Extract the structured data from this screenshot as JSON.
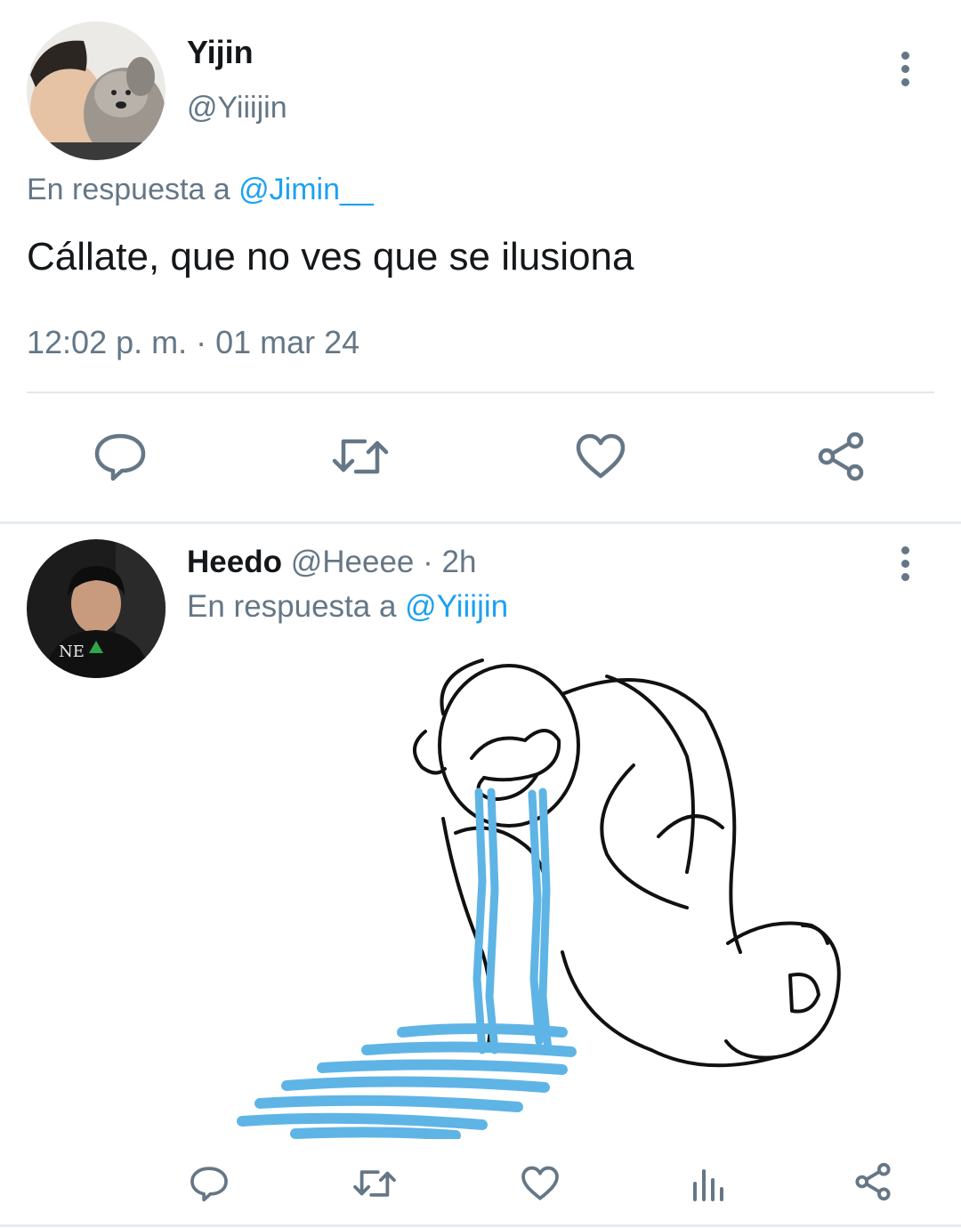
{
  "tweet": {
    "author": {
      "name": "Yijin",
      "handle": "@Yiiijin"
    },
    "reply_prefix": "En respuesta a",
    "reply_to": "@Jimin__",
    "text": "Cállate, que no ves que se ilusiona",
    "timestamp": "12:02 p. m. · 01 mar 24",
    "actions": [
      "reply-icon",
      "retweet-icon",
      "like-icon",
      "share-icon"
    ]
  },
  "reply": {
    "author": {
      "name": "Heedo",
      "handle": "@Heeee",
      "time": "· 2h"
    },
    "reply_prefix": "En respuesta a",
    "reply_to": "@Yiiijin",
    "media": "crying-cartoon-image",
    "actions": [
      "reply-icon",
      "retweet-icon",
      "like-icon",
      "analytics-icon",
      "share-icon"
    ]
  },
  "colors": {
    "accent": "#1da1f2",
    "muted": "#657786",
    "tear_blue": "#5fb4e6"
  }
}
